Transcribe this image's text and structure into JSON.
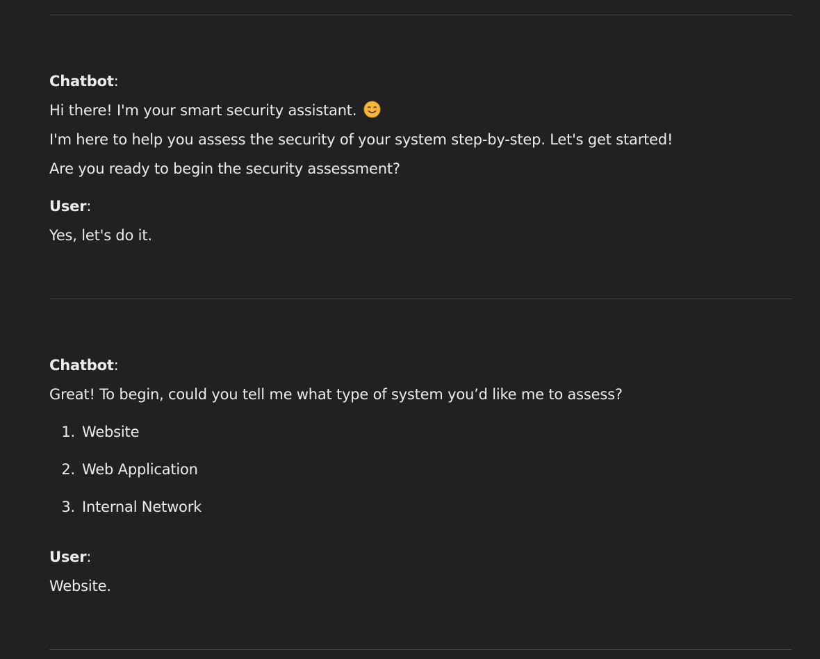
{
  "conversation": {
    "block1": {
      "chatbot_speaker": "Chatbot",
      "chatbot_lines": [
        "Hi there! I'm your smart security assistant.",
        "I'm here to help you assess the security of your system step-by-step. Let's get started!",
        "Are you ready to begin the security assessment?"
      ],
      "emoji": "smiling-face-icon",
      "user_speaker": "User",
      "user_reply": "Yes, let's do it."
    },
    "block2": {
      "chatbot_speaker": "Chatbot",
      "chatbot_line": "Great! To begin, could you tell me what type of system you’d like me to assess?",
      "options": [
        {
          "number": "1.",
          "label": "Website"
        },
        {
          "number": "2.",
          "label": "Web Application"
        },
        {
          "number": "3.",
          "label": "Internal Network"
        }
      ],
      "user_speaker": "User",
      "user_reply": "Website."
    }
  },
  "colors": {
    "background": "#212121",
    "text": "#ececec",
    "divider": "#4a4a4a",
    "emoji": "#f4b63f"
  }
}
